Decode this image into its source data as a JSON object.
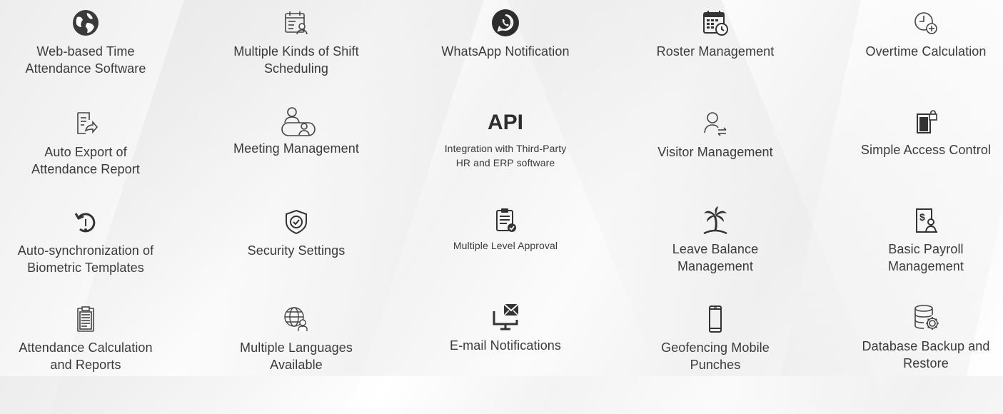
{
  "features": {
    "r1": {
      "c1": {
        "label": "Web-based Time\nAttendance Software",
        "icon": "globe-icon"
      },
      "c2": {
        "label": "Multiple Kinds of Shift\nScheduling",
        "icon": "calendar-person-icon"
      },
      "c3": {
        "label": "WhatsApp Notification",
        "icon": "whatsapp-icon"
      },
      "c4": {
        "label": "Roster Management",
        "icon": "calendar-clock-icon"
      },
      "c5": {
        "label": "Overtime Calculation",
        "icon": "clock-plus-icon"
      }
    },
    "r2": {
      "c1": {
        "label": "Auto Export of\nAttendance Report",
        "icon": "document-export-icon"
      },
      "c2": {
        "label": "Meeting Management",
        "icon": "meeting-icon"
      },
      "c3": {
        "label": "Integration with Third-Party\nHR and ERP software",
        "icon_text": "API",
        "icon": "api-icon"
      },
      "c4": {
        "label": "Visitor Management",
        "icon": "visitor-icon"
      },
      "c5": {
        "label": "Simple Access Control",
        "icon": "door-lock-icon"
      }
    },
    "r3": {
      "c1": {
        "label": "Auto-synchronization of\nBiometric Templates",
        "icon": "sync-fingerprint-icon"
      },
      "c2": {
        "label": "Security Settings",
        "icon": "shield-check-icon"
      },
      "c3": {
        "label": "Multiple Level Approval",
        "icon": "clipboard-check-icon"
      },
      "c4": {
        "label": "Leave Balance\nManagement",
        "icon": "palm-tree-icon"
      },
      "c5": {
        "label": "Basic Payroll\nManagement",
        "icon": "payroll-icon"
      }
    },
    "r4": {
      "c1": {
        "label": "Attendance Calculation\nand Reports",
        "icon": "report-clipboard-icon"
      },
      "c2": {
        "label": "Multiple Languages\nAvailable",
        "icon": "globe-person-icon"
      },
      "c3": {
        "label": "E-mail Notifications",
        "icon": "email-monitor-icon"
      },
      "c4": {
        "label": "Geofencing Mobile\nPunches",
        "icon": "mobile-phone-icon"
      },
      "c5": {
        "label": "Database Backup and\nRestore",
        "icon": "database-gear-icon"
      }
    }
  }
}
